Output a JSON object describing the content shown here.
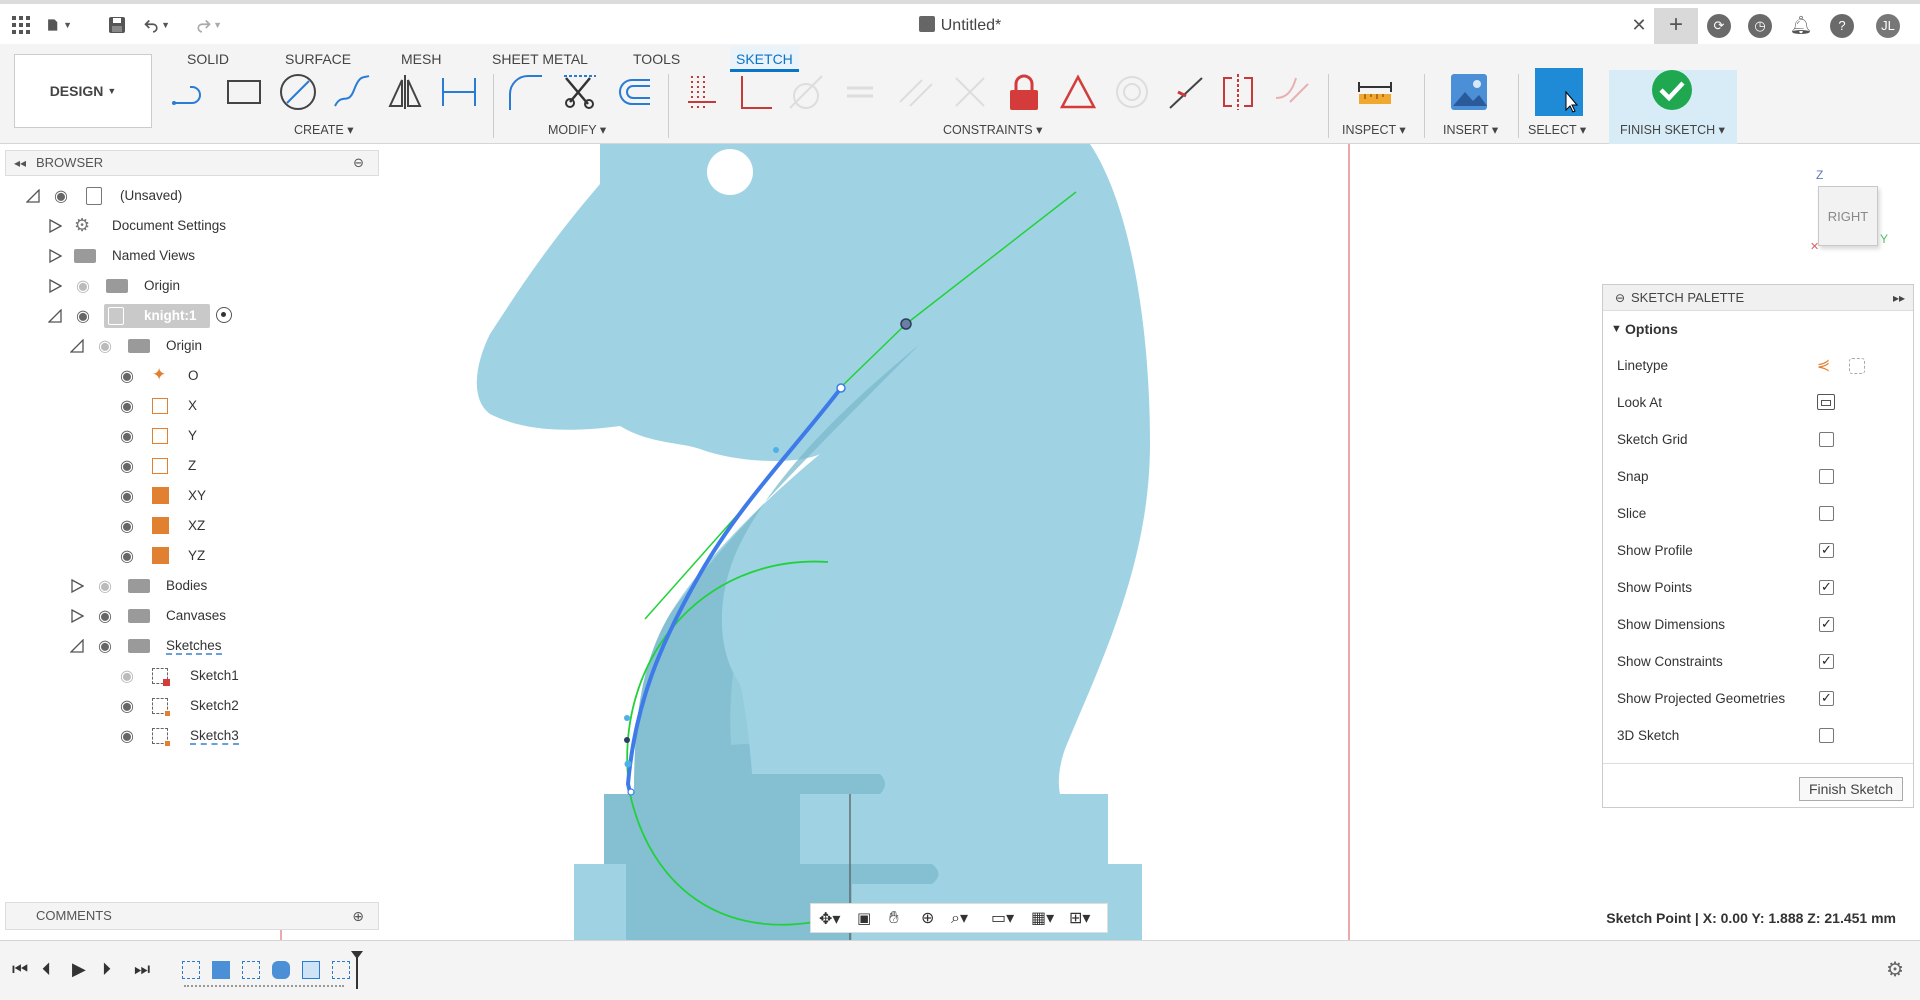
{
  "titlebar": {
    "document_title": "Untitled*",
    "user_initials": "JL"
  },
  "toolbar": {
    "workspace_label": "DESIGN",
    "tabs": [
      {
        "label": "SOLID"
      },
      {
        "label": "SURFACE"
      },
      {
        "label": "MESH"
      },
      {
        "label": "SHEET METAL"
      },
      {
        "label": "TOOLS"
      },
      {
        "label": "SKETCH",
        "active": true
      }
    ],
    "groups": {
      "create": "CREATE",
      "modify": "MODIFY",
      "constraints": "CONSTRAINTS",
      "inspect": "INSPECT",
      "insert": "INSERT",
      "select": "SELECT",
      "finish_sketch": "FINISH SKETCH"
    }
  },
  "browser": {
    "title": "BROWSER",
    "root": "(Unsaved)",
    "document_settings": "Document Settings",
    "named_views": "Named Views",
    "origin": "Origin",
    "component": "knight:1",
    "component_origin": "Origin",
    "origin_items": [
      "O",
      "X",
      "Y",
      "Z",
      "XY",
      "XZ",
      "YZ"
    ],
    "bodies": "Bodies",
    "canvases": "Canvases",
    "sketches": "Sketches",
    "sketch_items": [
      "Sketch1",
      "Sketch2",
      "Sketch3"
    ]
  },
  "comments": {
    "title": "COMMENTS"
  },
  "palette": {
    "title": "SKETCH PALETTE",
    "section": "Options",
    "options": [
      {
        "label": "Linetype",
        "type": "icons"
      },
      {
        "label": "Look At",
        "type": "icon"
      },
      {
        "label": "Sketch Grid",
        "checked": false
      },
      {
        "label": "Snap",
        "checked": false
      },
      {
        "label": "Slice",
        "checked": false
      },
      {
        "label": "Show Profile",
        "checked": true
      },
      {
        "label": "Show Points",
        "checked": true
      },
      {
        "label": "Show Dimensions",
        "checked": true
      },
      {
        "label": "Show Constraints",
        "checked": true
      },
      {
        "label": "Show Projected Geometries",
        "checked": true
      },
      {
        "label": "3D Sketch",
        "checked": false
      }
    ],
    "finish_button": "Finish Sketch"
  },
  "viewcube": {
    "face": "RIGHT",
    "axis_z": "Z",
    "axis_y": "Y"
  },
  "status": {
    "text": "Sketch Point | X: 0.00 Y: 1.888 Z: 21.451 mm"
  },
  "colors": {
    "accent": "#0a74c6",
    "body_fill": "#9fd3e3",
    "shadow_fill": "#7bb9cc",
    "spline": "#3f7be8",
    "construction": "#22d13a",
    "origin_axis": "#e07070"
  },
  "icons": {
    "apps": "grid-icon",
    "file": "file-icon",
    "save": "save-icon",
    "undo": "undo-icon",
    "redo": "redo-icon",
    "close": "close-icon",
    "new_tab": "plus-icon",
    "help": "help-icon",
    "notifications": "bell-icon"
  }
}
